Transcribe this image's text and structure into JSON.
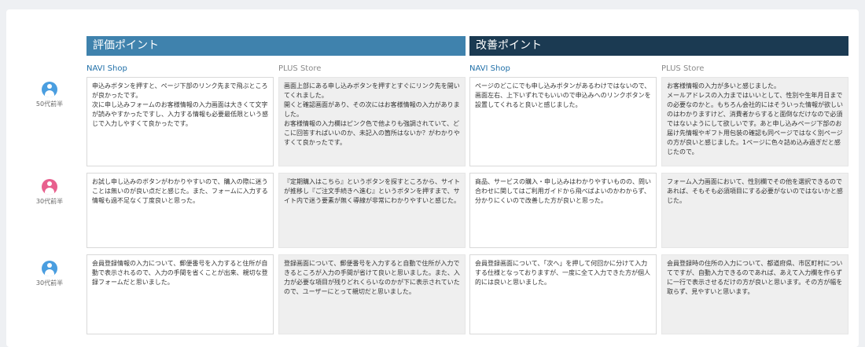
{
  "sections": {
    "evaluation": "評価ポイント",
    "improvement": "改善ポイント"
  },
  "columns": {
    "eval_navi": "NAVI Shop",
    "eval_plus": "PLUS Store",
    "impr_navi": "NAVI Shop",
    "impr_plus": "PLUS Store"
  },
  "colors": {
    "evaluation_header": "#3f82ad",
    "improvement_header": "#1b3a52",
    "avatar_blue": "#4a9ee0",
    "avatar_pink": "#e8608e"
  },
  "rows": [
    {
      "age": "50代前半",
      "avatar_color": "#4a9ee0",
      "icon": "user-icon",
      "eval_navi": "申込みボタンを押すと、ページ下部のリンク先まで飛ぶところが良かったです。\n次に申し込みフォームのお客様情報の入力画面は大きくて文字が読みやすかったですし、入力する情報も必要最低限という感じで入力しやすくて良かったです。",
      "eval_plus": "画面上部にある申し込みボタンを押すとすぐにリンク先を開いてくれました。\n開くと確認画面があり、その次にはお客様情報の入力がありました。\nお客様情報の入力欄はピンク色で他よりも強調されていて、どこに回答すればいいのか、未記入の箇所はないか？がわかりやすくて良かったです。",
      "impr_navi": "ページのどこにでも申し込みボタンがあるわけではないので、画面左右、上下いずれでもいいので申込みへのリンクボタンを設置してくれると良いと感じました。",
      "impr_plus": "お客様情報の入力が多いと感じました。\nメールアドレスの入力まではいいとして、性別や生年月日までの必要なのかと。もちろん会社的にはそういった情報が欲しいのはわかりますけど、消費者からすると面倒なだけなので必須ではないようにして欲しいです。あと申し込みページ下部のお届け先情報やギフト用包装の確認も同ページではなく別ページの方が良いと感じました。1ページに色々詰め込み過ぎだと感じたので。"
    },
    {
      "age": "30代前半",
      "avatar_color": "#e8608e",
      "icon": "user-icon",
      "eval_navi": "お試し申し込みのボタンがわかりやすいので、購入の際に迷うことは無いのが良い点だと感じた。また、フォームに入力する情報も過不足なく丁度良いと思った。",
      "eval_plus": "『定期購入はこちら』というボタンを探すところから、サイトが推移し『ご注文手続きへ進む』というボタンを押すまで、サイト内で迷う要素が無く導線が非常にわかりやすいと感じた。",
      "impr_navi": "商品、サービスの購入・申し込みはわかりやすいものの、問い合わせに関してはご利用ガイドから飛べばよいのかわからず、分かりにくいので改善した方が良いと思った。",
      "impr_plus": "フォーム入力画面において、性別欄でその他を選択できるのであれば、そもそも必須項目にする必要がないのではないかと感じた。"
    },
    {
      "age": "30代前半",
      "avatar_color": "#4a9ee0",
      "icon": "user-icon",
      "eval_navi": "会員登録情報の入力について、郵便番号を入力すると住所が自動で表示されるので、入力の手間を省くことが出来、親切な登録フォームだと思いました。",
      "eval_plus": "登録画面について、郵便番号を入力すると自動で住所が入力できるところが入力の手間が省けて良いと思いました。また、入力が必要な項目が残りどれくらいなのかが下に表示されていたので、ユーザーにとって親切だと思いました。",
      "impr_navi": "会員登録画面について、「次へ」を押して何回かに分けて入力する仕様となっておりますが、一度に全て入力できた方が個人的には良いと思いました。",
      "impr_plus": "会員登録時の住所の入力について、都道府県、市区町村についてですが、自動入力できるのであれば、あえて入力欄を作らずに一行で表示させるだけの方が良いと思います。その方が幅を取らず、見やすいと思います。"
    }
  ]
}
